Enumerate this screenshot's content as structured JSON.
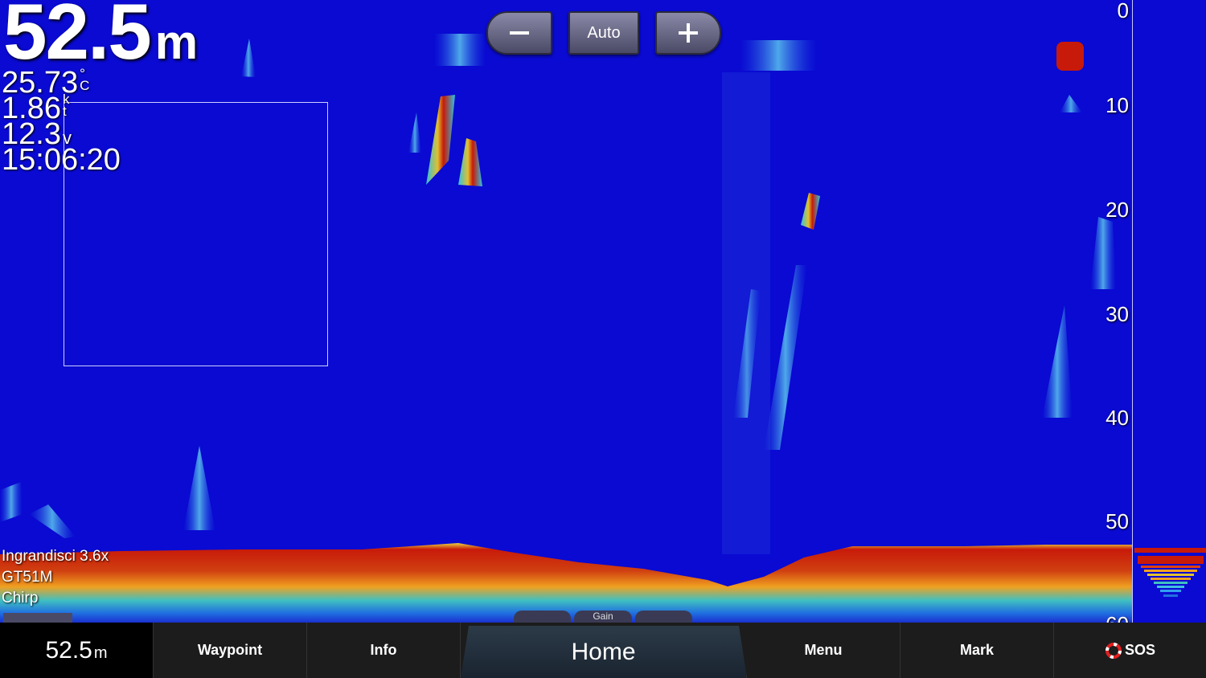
{
  "readouts": {
    "depth_value": "52.5",
    "depth_unit": "m",
    "temperature": "25.73",
    "temperature_unit_top": "°",
    "temperature_unit_bottom": "C",
    "speed": "1.86",
    "speed_unit_top": "k",
    "speed_unit_bottom": "t",
    "voltage": "12.3",
    "voltage_unit": "v",
    "time": "15:06:20"
  },
  "zoom_controls": {
    "minus_icon": "minus-icon",
    "auto_label": "Auto",
    "plus_icon": "plus-icon"
  },
  "depth_scale": [
    "0",
    "10",
    "20",
    "30",
    "40",
    "50",
    "60"
  ],
  "info_tags": {
    "zoom": "Ingrandisci 3.6x",
    "transducer": "GT51M",
    "mode": "Chirp"
  },
  "sub_bar": {
    "gain_label": "Gain"
  },
  "bottom_nav": {
    "depth_value": "52.5",
    "depth_unit": "m",
    "waypoint": "Waypoint",
    "info": "Info",
    "home": "Home",
    "menu": "Menu",
    "mark": "Mark",
    "sos": "SOS",
    "sos_icon": "lifebuoy-icon"
  },
  "colors": {
    "water": "#0a0ad2",
    "bottom_strong": "#c81a0a",
    "bottom_mid": "#f0a020",
    "bottom_weak": "#20c0e0",
    "sos_red": "#e02020"
  }
}
